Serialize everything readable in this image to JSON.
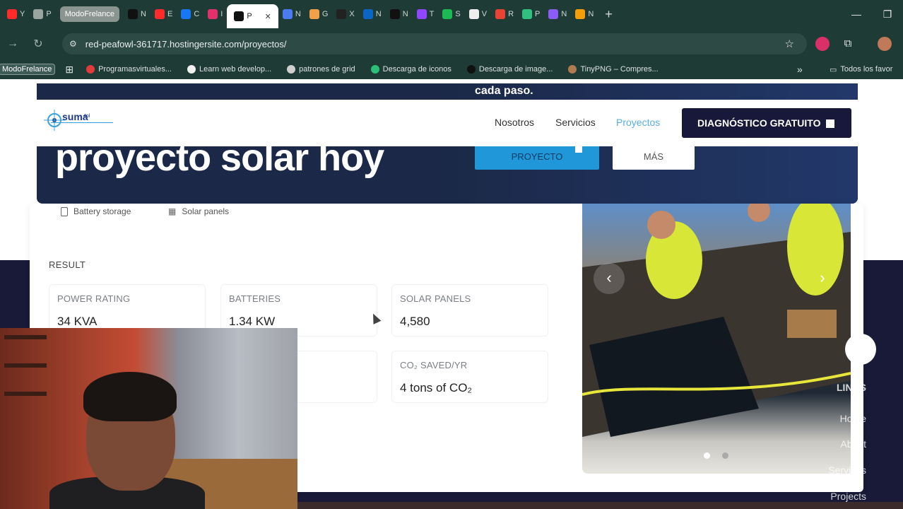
{
  "browser": {
    "tabs": [
      {
        "label": "Y",
        "color": "#ff2a2a"
      },
      {
        "label": "P",
        "color": "#9aa5a2"
      },
      {
        "label": "ModoFrelance",
        "pill": true
      },
      {
        "label": "N",
        "color": "#111111"
      },
      {
        "label": "E",
        "color": "#ff2a2a"
      },
      {
        "label": "C",
        "color": "#1877f2"
      },
      {
        "label": "I",
        "color": "#e1306c"
      },
      {
        "label": "P",
        "active": true,
        "color": "#111111"
      },
      {
        "label": "N",
        "color": "#4a7cf0"
      },
      {
        "label": "G",
        "color": "#f2a14b"
      },
      {
        "label": "X",
        "color": "#222222"
      },
      {
        "label": "N",
        "color": "#0a66c2"
      },
      {
        "label": "N",
        "color": "#111111"
      },
      {
        "label": "T",
        "color": "#9146ff"
      },
      {
        "label": "S",
        "color": "#1db954"
      },
      {
        "label": "V",
        "color": "#eeeeee"
      },
      {
        "label": "R",
        "color": "#ea4335"
      },
      {
        "label": "P",
        "color": "#2ec27e"
      },
      {
        "label": "N",
        "color": "#8b5cf6"
      },
      {
        "label": "N",
        "color": "#f59e0b"
      }
    ],
    "active_close": "✕",
    "new_tab": "+",
    "url": "red-peafowl-361717.hostingersite.com/proyectos/",
    "bookmarks": [
      {
        "label": "ModoFrelance",
        "first": true
      },
      {
        "label": "Programasvirtuales...",
        "color": "#e23b3b"
      },
      {
        "label": "Learn web develop...",
        "color": "#f0f0f0"
      },
      {
        "label": "patrones de grid",
        "color": "#cfcfcf"
      },
      {
        "label": "Descarga de iconos",
        "color": "#2bbf7a"
      },
      {
        "label": "Descarga de image...",
        "color": "#111111"
      },
      {
        "label": "TinyPNG – Compres...",
        "color": "#b07b4f"
      }
    ],
    "bookmarks_more": "»",
    "bookmarks_folder": "Todos los favor"
  },
  "hero": {
    "top_text": "cada paso.",
    "title": "proyecto solar hoy",
    "primary_button": "PROYECTO",
    "secondary_button": "MÁS"
  },
  "site_nav": {
    "logo_text": "suma",
    "logo_sub": "4pl",
    "links": [
      "Nosotros",
      "Servicios",
      "Proyectos"
    ],
    "active_link": "Proyectos",
    "cta": "DIAGNÓSTICO GRATUITO"
  },
  "project": {
    "tags": [
      "Battery storage",
      "Solar panels"
    ],
    "result_label": "RESULT",
    "stats": [
      {
        "label": "POWER RATING",
        "value": "34 KVA"
      },
      {
        "label": "BATTERIES",
        "value": "1.34 KW"
      },
      {
        "label": "SOLAR PANELS",
        "value": "4,580"
      },
      {
        "label": "CO₂ SAVED/YR",
        "value": "4 tons of CO₂"
      }
    ],
    "carousel_prev": "‹",
    "carousel_next": "›"
  },
  "footer": {
    "heading": "LINKS",
    "links": [
      "Home",
      "About",
      "Services",
      "Projects"
    ]
  }
}
